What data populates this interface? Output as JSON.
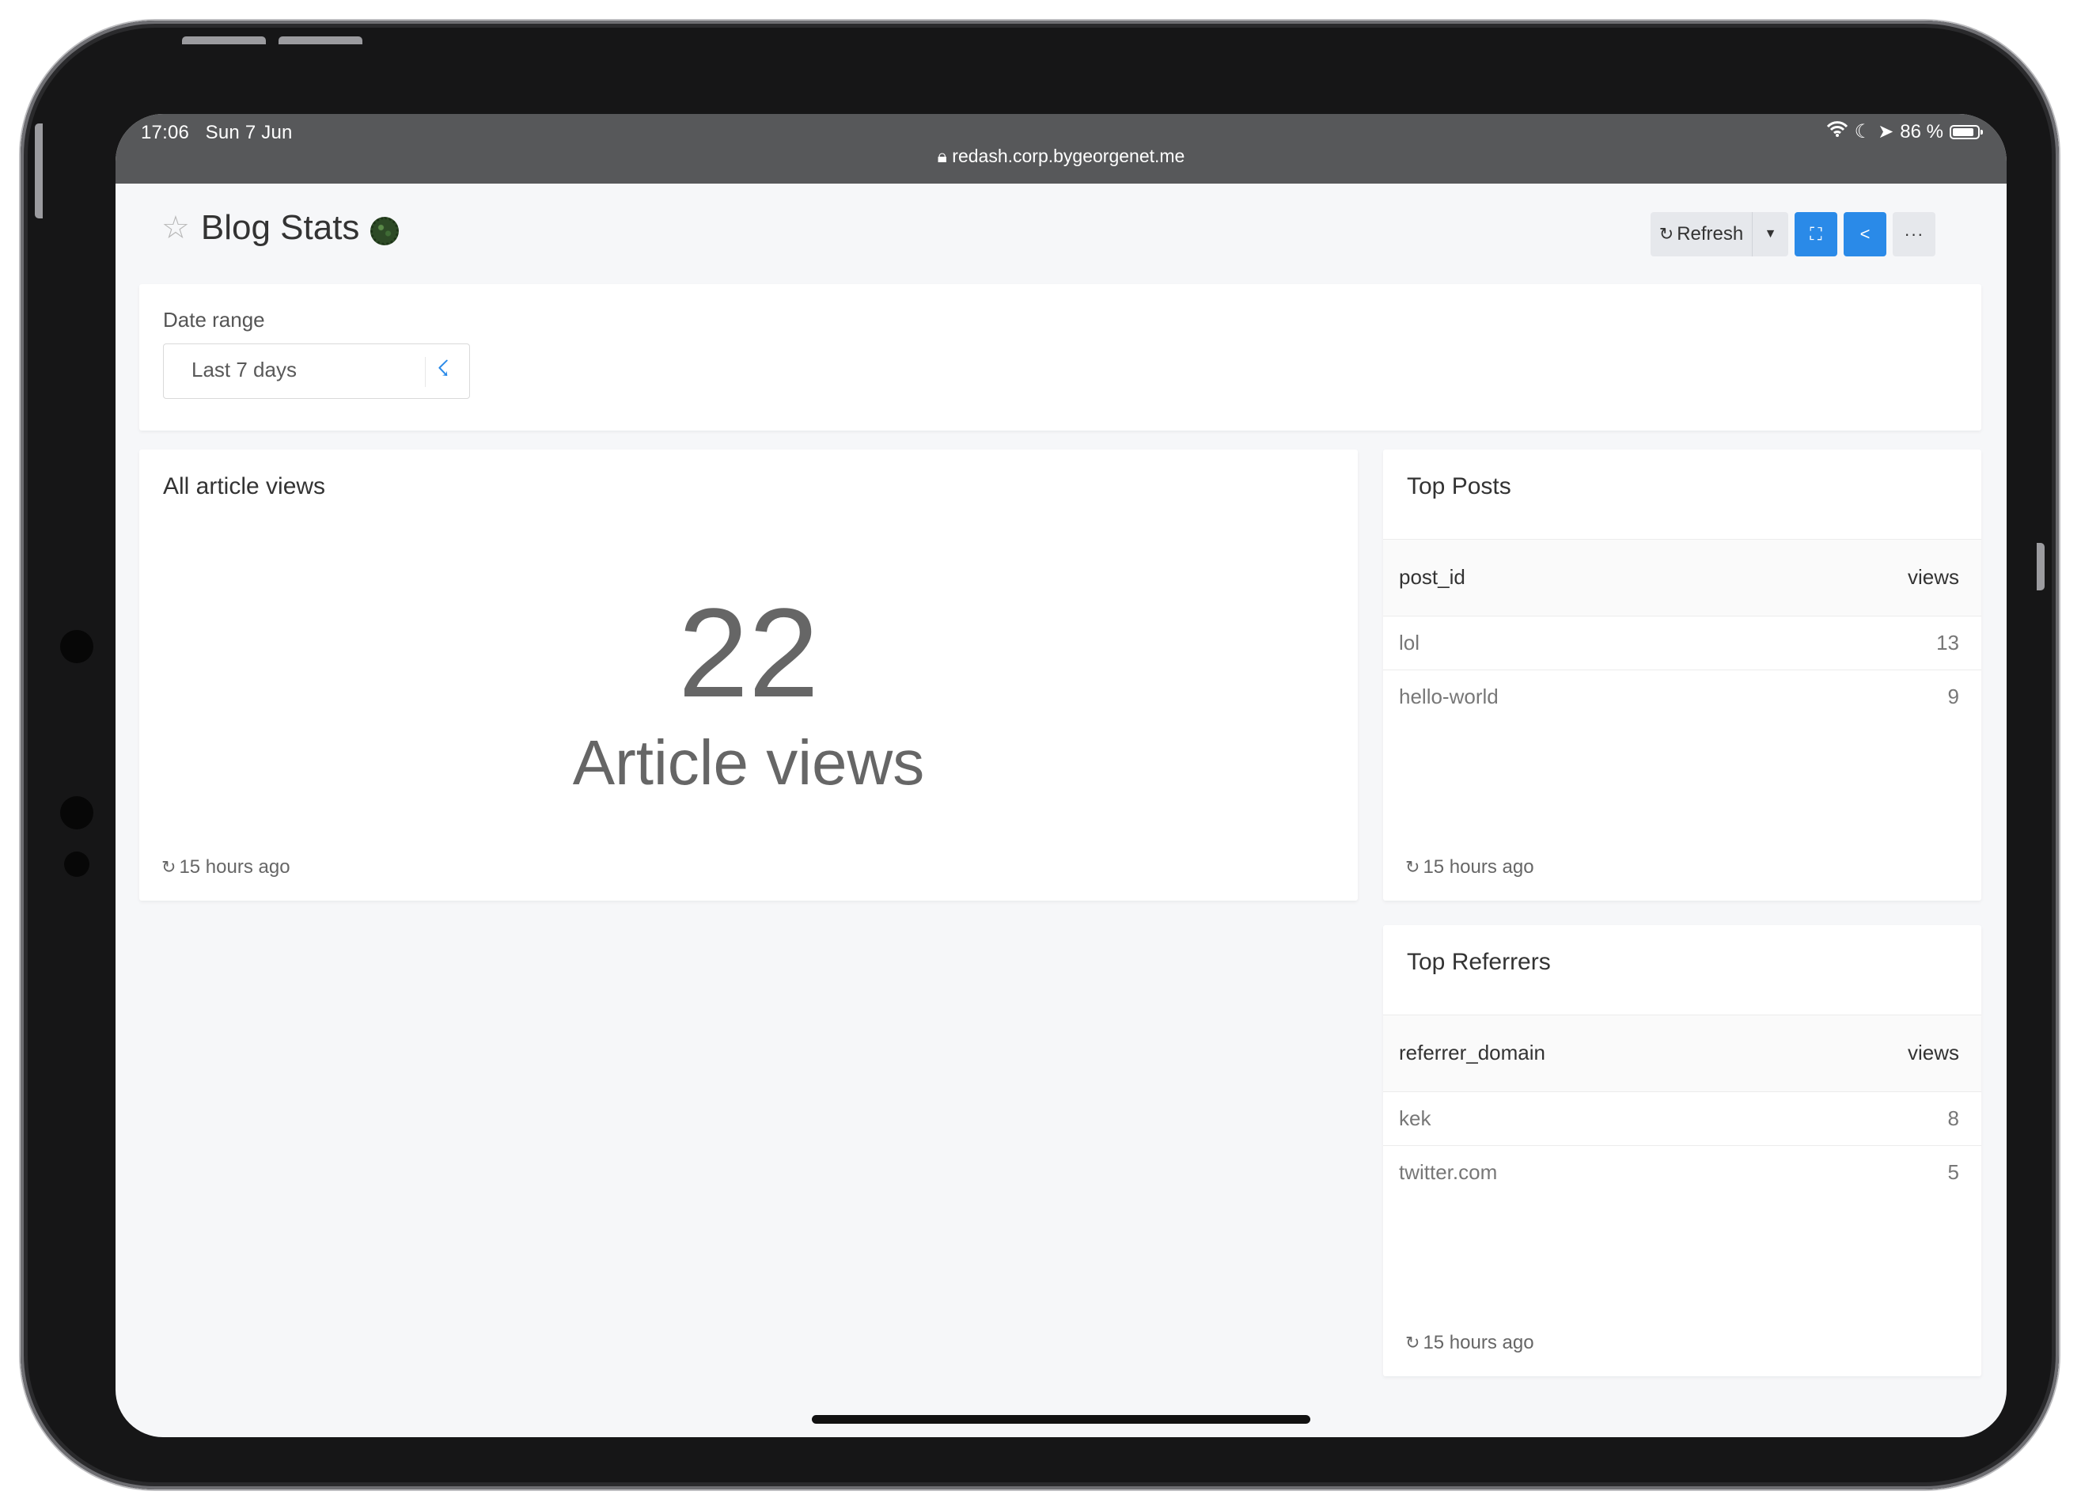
{
  "status_bar": {
    "time": "17:06",
    "date": "Sun 7 Jun",
    "url": "redash.corp.bygeorgenet.me",
    "battery": "86 %",
    "battery_level": 0.86
  },
  "dashboard": {
    "title": "Blog Stats",
    "toolbar": {
      "refresh_label": "Refresh"
    }
  },
  "filters": {
    "date_range": {
      "label": "Date range",
      "value": "Last 7 days"
    }
  },
  "widgets": {
    "article_views": {
      "title": "All article views",
      "value": "22",
      "label": "Article views",
      "updated": "15 hours ago"
    },
    "top_posts": {
      "title": "Top Posts",
      "columns": [
        "post_id",
        "views"
      ],
      "rows": [
        [
          "lol",
          "13"
        ],
        [
          "hello-world",
          "9"
        ]
      ],
      "updated": "15 hours ago"
    },
    "top_referrers": {
      "title": "Top Referrers",
      "columns": [
        "referrer_domain",
        "views"
      ],
      "rows": [
        [
          "kek",
          "8"
        ],
        [
          "twitter.com",
          "5"
        ]
      ],
      "updated": "15 hours ago"
    }
  },
  "colors": {
    "accent": "#2a8ae8",
    "status_bar": "#57585a",
    "page_bg": "#f6f7f9"
  }
}
